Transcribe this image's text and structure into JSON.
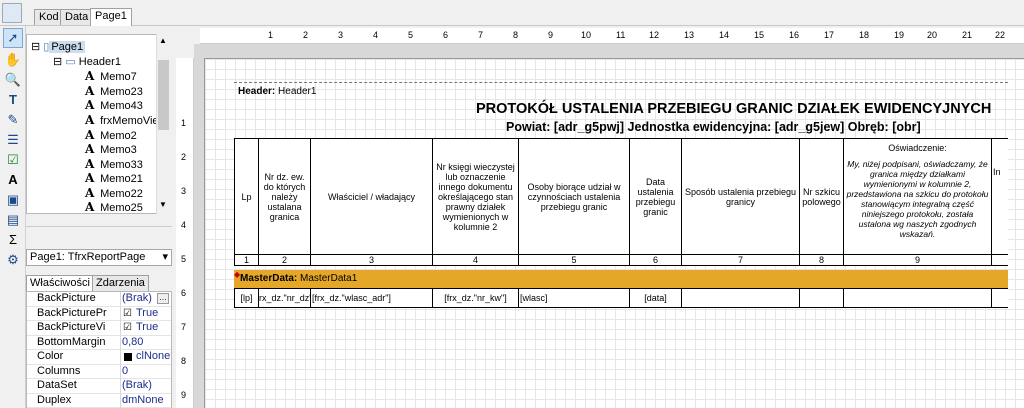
{
  "tabs": [
    {
      "label": "Kod",
      "active": false
    },
    {
      "label": "Data",
      "active": false
    },
    {
      "label": "Page1",
      "active": true
    }
  ],
  "toolbar_icons": [
    "pointer-icon",
    "hand-icon",
    "zoom-icon",
    "text-tool-icon",
    "paint-icon",
    "band-icon",
    "checkbox-icon",
    "memo-icon",
    "picture-icon",
    "subreport-icon",
    "sum-icon",
    "wizard-icon"
  ],
  "tree": {
    "items": [
      {
        "label": "Page1",
        "level": 0,
        "type": "page"
      },
      {
        "label": "Header1",
        "level": 1,
        "type": "band"
      },
      {
        "label": "Memo7",
        "level": 2,
        "type": "memo"
      },
      {
        "label": "Memo23",
        "level": 2,
        "type": "memo"
      },
      {
        "label": "Memo43",
        "level": 2,
        "type": "memo"
      },
      {
        "label": "frxMemoView",
        "level": 2,
        "type": "memo"
      },
      {
        "label": "Memo2",
        "level": 2,
        "type": "memo"
      },
      {
        "label": "Memo3",
        "level": 2,
        "type": "memo"
      },
      {
        "label": "Memo33",
        "level": 2,
        "type": "memo"
      },
      {
        "label": "Memo21",
        "level": 2,
        "type": "memo"
      },
      {
        "label": "Memo22",
        "level": 2,
        "type": "memo"
      },
      {
        "label": "Memo25",
        "level": 2,
        "type": "memo"
      }
    ],
    "memo_glyph": "A"
  },
  "combo": {
    "value": "Page1: TfrxReportPage",
    "arrow": "▾"
  },
  "inspector": {
    "tabs": [
      "Właściwości",
      "Zdarzenia"
    ],
    "rows": [
      {
        "name": "BackPicture",
        "value": "(Brak)",
        "has_button": true
      },
      {
        "name": "BackPicturePr",
        "value": "True",
        "checkbox": true
      },
      {
        "name": "BackPictureVi",
        "value": "True",
        "checkbox": true
      },
      {
        "name": "BottomMargin",
        "value": "0,80"
      },
      {
        "name": "Color",
        "value": "clNone",
        "swatch": "#000000"
      },
      {
        "name": "Columns",
        "value": "0"
      },
      {
        "name": "DataSet",
        "value": "(Brak)"
      },
      {
        "name": "Duplex",
        "value": "dmNone"
      }
    ]
  },
  "ruler": {
    "top_numbers": [
      "1",
      "2",
      "3",
      "4",
      "5",
      "6",
      "7",
      "8",
      "9",
      "10",
      "11",
      "12",
      "13",
      "14",
      "15",
      "16",
      "17",
      "18",
      "19",
      "20",
      "21",
      "22"
    ],
    "left_numbers": [
      "1",
      "2",
      "3",
      "4",
      "5",
      "6",
      "7",
      "8",
      "9"
    ]
  },
  "report": {
    "header_band": {
      "label_bold": "Header:",
      "label": "Header1"
    },
    "title": "PROTOKÓŁ USTALENIA PRZEBIEGU GRANIC DZIAŁEK EWIDENCYJNYCH",
    "subtitle": "Powiat: [adr_g5pwj]   Jednostka ewidencyjna: [adr_g5jew]   Obręb: [obr]",
    "columns": [
      {
        "text": "Lp",
        "num": "1"
      },
      {
        "text": "Nr dz. ew. do których należy ustalana granica",
        "num": "2"
      },
      {
        "text": "Właściciel / władający",
        "num": "3"
      },
      {
        "text": "Nr księgi wieczystej lub oznaczenie innego dokumentu określającego stan prawny działek wymienionych w kolumnie 2",
        "num": "4"
      },
      {
        "text": "Osoby biorące udział w czynnościach ustalenia przebiegu granic",
        "num": "5"
      },
      {
        "text": "Data ustalenia przebiegu granic",
        "num": "6"
      },
      {
        "text": "Sposób ustalenia przebiegu granicy",
        "num": "7"
      },
      {
        "text": "Nr szkicu polowego",
        "num": "8"
      },
      {
        "text": "Oświadczenie:",
        "num": "9"
      },
      {
        "text": "In",
        "num": ""
      }
    ],
    "declaration": "My, niżej podpisani, oświadczamy, że granica między działkami wymienionymi w kolumnie 2, przedstawiona na szkicu do protokołu stanowiącym integralną część niniejszego protokołu, została ustalona wg naszych zgodnych wskazań.",
    "col10_partial": "In",
    "master_band": {
      "label_bold": "MasterData:",
      "label": "MasterData1",
      "color": "#e5a727"
    },
    "data_cells": [
      "[lp]",
      "[frx_dz.\"nr_dz\"]",
      "[frx_dz.\"wlasc_adr\"]",
      "[frx_dz.\"nr_kw\"]",
      "[wlasc]",
      "[data]",
      "",
      "",
      ""
    ]
  }
}
